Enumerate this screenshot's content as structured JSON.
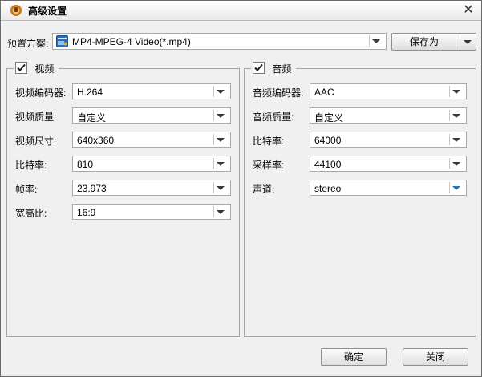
{
  "window": {
    "title": "高级设置"
  },
  "preset": {
    "label": "预置方案:",
    "value": "MP4-MPEG-4 Video(*.mp4)",
    "save_as_label": "保存为"
  },
  "video": {
    "title": "视频",
    "checked": true,
    "fields": [
      {
        "label": "视频编码器:",
        "value": "H.264"
      },
      {
        "label": "视频质量:",
        "value": "自定义"
      },
      {
        "label": "视频尺寸:",
        "value": "640x360"
      },
      {
        "label": "比特率:",
        "value": "810"
      },
      {
        "label": "帧率:",
        "value": "23.973"
      },
      {
        "label": "宽高比:",
        "value": "16:9"
      }
    ]
  },
  "audio": {
    "title": "音频",
    "checked": true,
    "fields": [
      {
        "label": "音频编码器:",
        "value": "AAC"
      },
      {
        "label": "音频质量:",
        "value": "自定义"
      },
      {
        "label": "比特率:",
        "value": "64000"
      },
      {
        "label": "采样率:",
        "value": "44100"
      },
      {
        "label": "声道:",
        "value": "stereo"
      }
    ]
  },
  "buttons": {
    "ok_label": "确定",
    "close_label": "关闭"
  },
  "colors": {
    "dialog_bg": "#f0f0f0",
    "active_arrow": "#2b6fb5"
  },
  "icons": {
    "app": "app-logo-icon",
    "preset": "video-file-icon",
    "close": "close-icon"
  }
}
